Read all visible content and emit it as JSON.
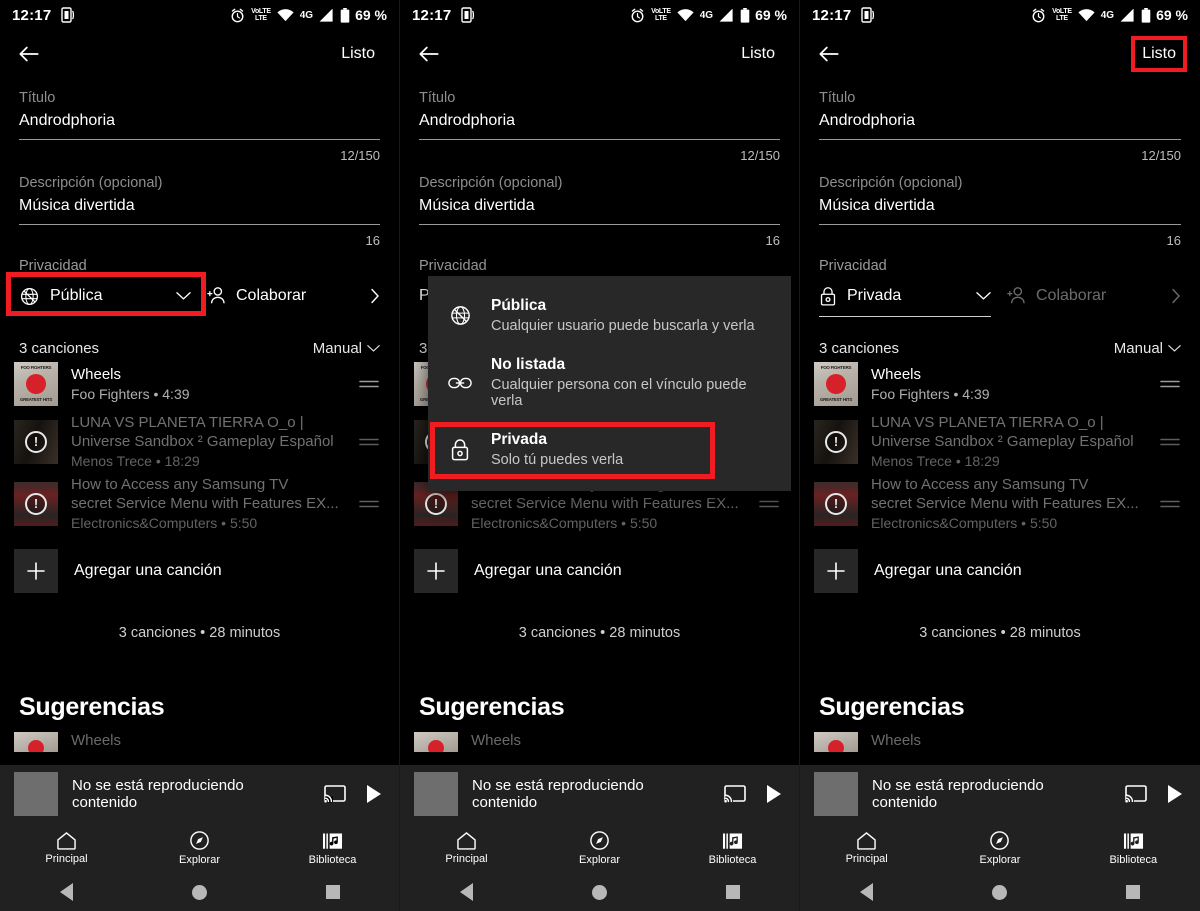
{
  "status_bar": {
    "time": "12:17",
    "battery": "69 %",
    "network": "4G",
    "volte_line1": "VoLTE",
    "volte_line2": "LTE",
    "icons": [
      "nfc-icon",
      "alarm-icon",
      "volte-icon",
      "wifi-icon",
      "signal-icon",
      "battery-icon"
    ]
  },
  "app_bar": {
    "back_label": "back-arrow",
    "done_label": "Listo"
  },
  "form": {
    "title_label": "Título",
    "title_value": "Androdphoria",
    "title_counter": "12/150",
    "description_label": "Descripción (opcional)",
    "description_value": "Música divertida",
    "description_counter": "16",
    "privacy_label": "Privacidad",
    "collaborate_label": "Colaborar"
  },
  "privacy_states": {
    "panel1": "Pública",
    "panel2": "Pública",
    "panel3": "Privada"
  },
  "privacy_menu": {
    "items": [
      {
        "icon": "globe-icon",
        "title": "Pública",
        "description": "Cualquier usuario puede buscarla y verla",
        "highlighted": false
      },
      {
        "icon": "link-icon",
        "title": "No listada",
        "description": "Cualquier persona con el vínculo puede verla",
        "highlighted": false
      },
      {
        "icon": "lock-icon",
        "title": "Privada",
        "description": "Solo tú puedes verla",
        "highlighted": true
      }
    ]
  },
  "songs_section": {
    "count_label": "3 canciones",
    "sort_label": "Manual",
    "add_song_label": "Agregar una canción",
    "totals_label": "3 canciones • 28 minutos",
    "items": [
      {
        "title": "Wheels",
        "subtitle": "Foo Fighters • 4:39",
        "available": true,
        "art": "foo-fighters-greatest-hits",
        "art_top": "FOO FIGHTERS",
        "art_bottom": "GREATEST HITS"
      },
      {
        "title_line1": "LUNA VS PLANETA TIERRA O_o |",
        "title_line2": "Universe Sandbox ² Gameplay Español",
        "subtitle": "Menos Trece • 18:29",
        "available": false,
        "art": "unavailable-thumbnail"
      },
      {
        "title_line1": "How to Access any Samsung TV",
        "title_line2": "secret Service Menu with Features EX...",
        "subtitle": "Electronics&Computers • 5:50",
        "available": false,
        "art": "unavailable-thumbnail"
      }
    ]
  },
  "suggestions": {
    "heading": "Sugerencias"
  },
  "mini_player": {
    "text": "No se está reproduciendo contenido",
    "cast_icon": "cast-icon",
    "play_icon": "play-icon"
  },
  "bottom_nav": {
    "items": [
      {
        "label": "Principal",
        "icon": "home-icon"
      },
      {
        "label": "Explorar",
        "icon": "compass-icon"
      },
      {
        "label": "Biblioteca",
        "icon": "library-music-icon"
      }
    ]
  },
  "system_nav": {
    "back": "system-back-icon",
    "home": "system-home-icon",
    "recents": "system-recents-icon"
  },
  "colors": {
    "highlight": "#f01c21",
    "background": "#000000",
    "menu_background": "#282828",
    "bottom_background": "#212121",
    "accent_text": "#ffffff",
    "muted_text": "#8e8e8e"
  }
}
